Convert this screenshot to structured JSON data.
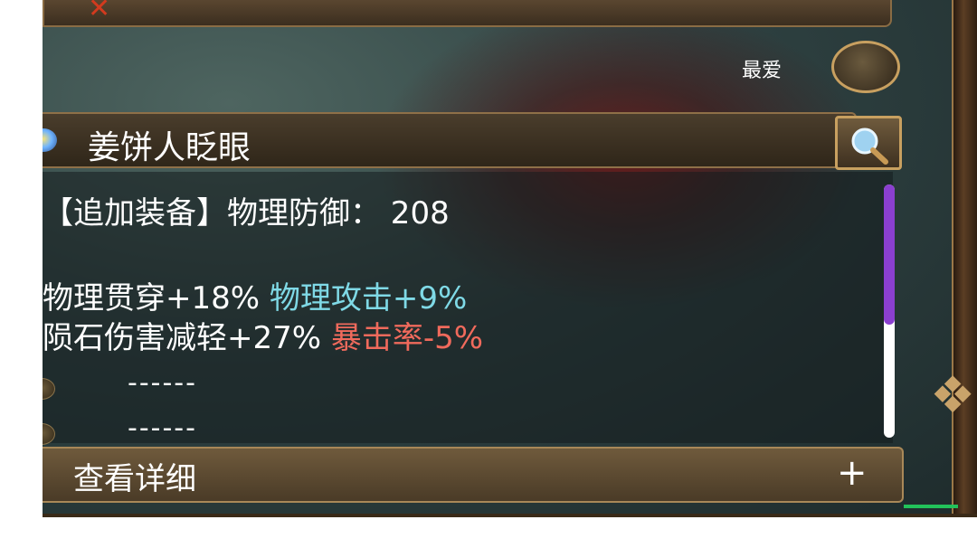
{
  "favorite": {
    "label": "最爱"
  },
  "item": {
    "name": "姜饼人眨眼",
    "extra_equip_line": "【追加装备】物理防御： 208",
    "stats": [
      {
        "left": "物理贯穿+18%",
        "right": "物理攻击+9%",
        "right_color": "#7fd9e6"
      },
      {
        "left": "陨石伤害减轻+27%",
        "right": "暴击率-5%",
        "right_color": "#f06a5c"
      }
    ],
    "slots": [
      "------",
      "------"
    ]
  },
  "details": {
    "label": "查看详细",
    "expand_symbol": "+"
  },
  "icons": {
    "search": "magnifier-icon",
    "favorite": "favorite-toggle",
    "rarity": "rarity-gem-icon"
  },
  "colors": {
    "accent_gold": "#c8a060",
    "scrollbar_thumb": "#8b3fd0"
  }
}
